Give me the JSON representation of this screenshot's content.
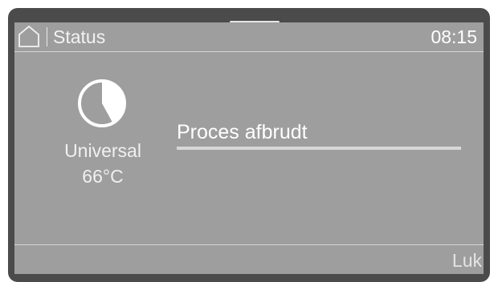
{
  "header": {
    "home_icon": "home-icon",
    "title": "Status",
    "time": "08:15"
  },
  "program": {
    "icon": "program-pie-icon",
    "name": "Universal",
    "temperature": "66°C"
  },
  "status": {
    "message": "Proces afbrudt",
    "progress": 1.0
  },
  "footer": {
    "close_label": "Luk"
  },
  "colors": {
    "bezel": "#4b4b4b",
    "screen": "#9e9e9e",
    "text": "#ffffff",
    "rule": "#d4d4d4"
  }
}
